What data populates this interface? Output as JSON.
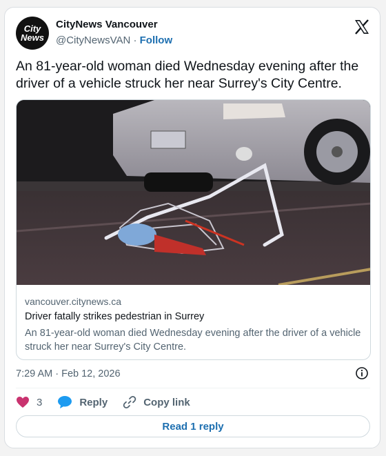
{
  "account": {
    "logo_line1": "City",
    "logo_line2": "News",
    "name": "CityNews Vancouver",
    "handle": "@CityNewsVAN",
    "separator": "·",
    "follow_label": "Follow"
  },
  "tweet": {
    "text": "An 81-year-old woman died Wednesday evening after the driver of a vehicle struck her near Surrey's City Centre.",
    "timestamp": "7:29 AM · Feb 12, 2026"
  },
  "link_card": {
    "domain": "vancouver.citynews.ca",
    "title": "Driver fatally strikes pedestrian in Surrey",
    "description": "An 81-year-old woman died Wednesday evening after the driver of a vehicle struck her near Surrey's City Centre."
  },
  "actions": {
    "like_count": "3",
    "reply_label": "Reply",
    "copy_link_label": "Copy link"
  },
  "read_replies_label": "Read 1 reply",
  "colors": {
    "accent": "#1d6fb0",
    "like": "#c9336f",
    "reply_bubble": "#1d9bf0",
    "muted_text": "#536471"
  }
}
